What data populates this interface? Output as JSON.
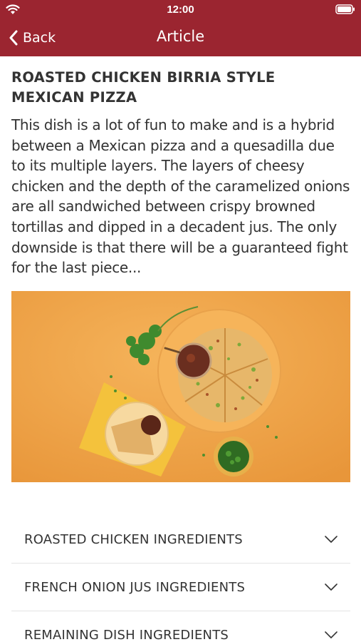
{
  "status_bar": {
    "time": "12:00"
  },
  "nav": {
    "back_label": "Back",
    "title": "Article"
  },
  "article": {
    "title": "ROASTED CHICKEN BIRRIA STYLE MEXICAN PIZZA",
    "body": "This dish is a lot of fun to make and is a hybrid between a Mexican pizza and a quesadilla due to its multiple layers. The layers of cheesy chicken and the depth of the caramelized onions are all sandwiched between crispy browned tortillas and dipped in a decadent jus. The only downside is that there will be a guaranteed fight for the last piece..."
  },
  "sections": [
    {
      "label": "ROASTED CHICKEN INGREDIENTS"
    },
    {
      "label": "FRENCH ONION JUS INGREDIENTS"
    },
    {
      "label": "REMAINING DISH INGREDIENTS"
    }
  ],
  "colors": {
    "header_bg": "#9b2530",
    "image_bg": "#f0a64a"
  }
}
